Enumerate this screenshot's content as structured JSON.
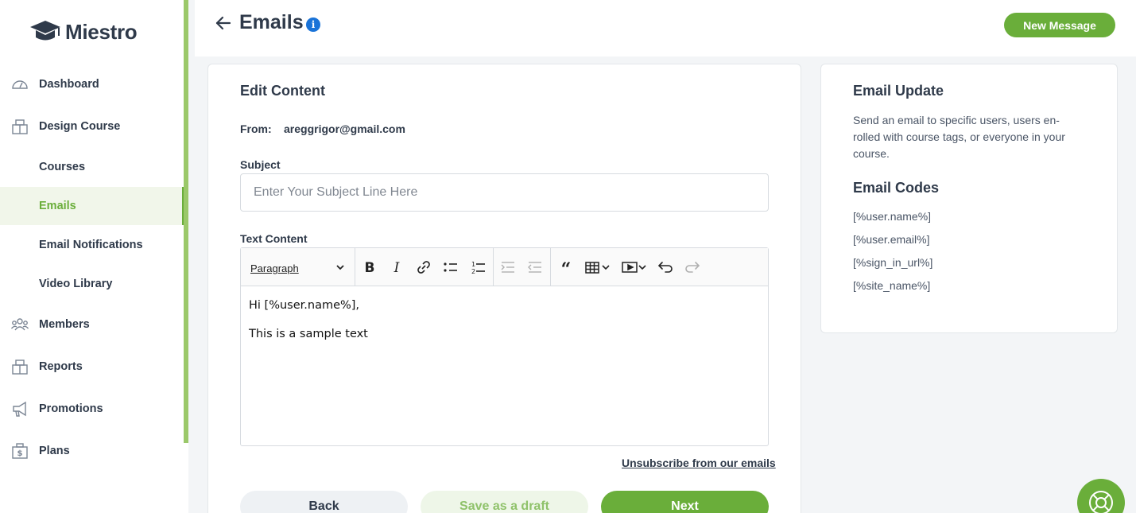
{
  "app": {
    "name": "Miestro"
  },
  "sidebar": {
    "items": [
      {
        "label": "Dashboard",
        "icon": "gauge-icon"
      },
      {
        "label": "Design Course",
        "icon": "box-icon"
      },
      {
        "label": "Courses"
      },
      {
        "label": "Emails",
        "active": true
      },
      {
        "label": "Email Notifications"
      },
      {
        "label": "Video Library"
      },
      {
        "label": "Members",
        "icon": "users-icon"
      },
      {
        "label": "Reports",
        "icon": "box-icon"
      },
      {
        "label": "Promotions",
        "icon": "megaphone-icon"
      },
      {
        "label": "Plans",
        "icon": "dollar-box-icon"
      }
    ]
  },
  "header": {
    "title": "Emails",
    "info_icon": "i",
    "new_message_label": "New Message"
  },
  "editor_card": {
    "title": "Edit Content",
    "from_label": "From:",
    "from_value": "areggrigor@gmail.com",
    "subject_label": "Subject",
    "subject_placeholder": "Enter Your Subject Line Here",
    "subject_value": "",
    "content_label": "Text Content",
    "paragraph_select": "Paragraph",
    "body_lines": [
      "Hi [%user.name%],",
      "This is a sample text"
    ],
    "unsubscribe_label": "Unsubscribe from our emails",
    "back_label": "Back",
    "draft_label": "Save as a draft",
    "next_label": "Next"
  },
  "side_card": {
    "title": "Email Update",
    "description": "Send an email to specific users, users en-rolled with course tags, or everyone in your course.",
    "codes_title": "Email Codes",
    "codes": [
      "[%user.name%]",
      "[%user.email%]",
      "[%sign_in_url%]",
      "[%site_name%]"
    ]
  },
  "colors": {
    "accent": "#6aae3a",
    "text": "#2f3a4a",
    "info": "#1a73d8"
  }
}
